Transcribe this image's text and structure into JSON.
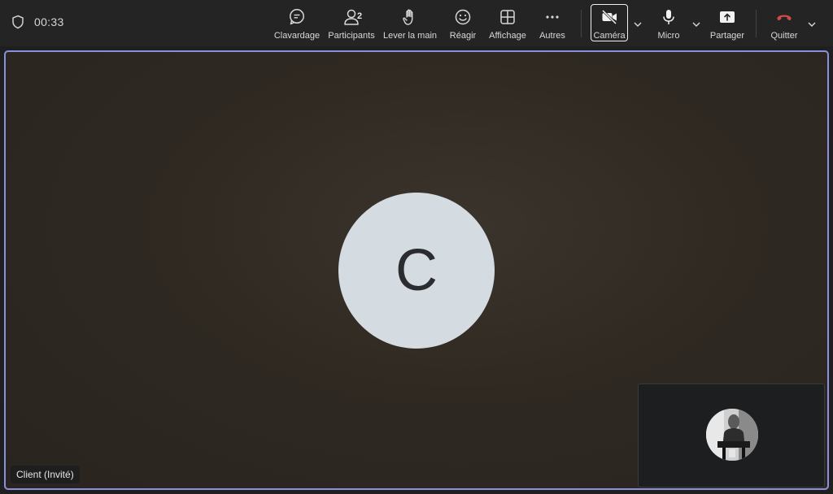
{
  "meeting": {
    "timer": "00:33"
  },
  "toolbar": {
    "chat_label": "Clavardage",
    "participants_label": "Participants",
    "participants_count": "2",
    "raise_hand_label": "Lever la main",
    "react_label": "Réagir",
    "view_label": "Affichage",
    "more_label": "Autres",
    "camera_label": "Caméra",
    "mic_label": "Micro",
    "share_label": "Partager",
    "leave_label": "Quitter"
  },
  "stage": {
    "avatar_initial": "C",
    "name_tag": "Client (Invité)"
  },
  "colors": {
    "stage_border": "#8b8fe0",
    "avatar_bg": "#d4dbe1",
    "topbar_bg": "#242424"
  }
}
